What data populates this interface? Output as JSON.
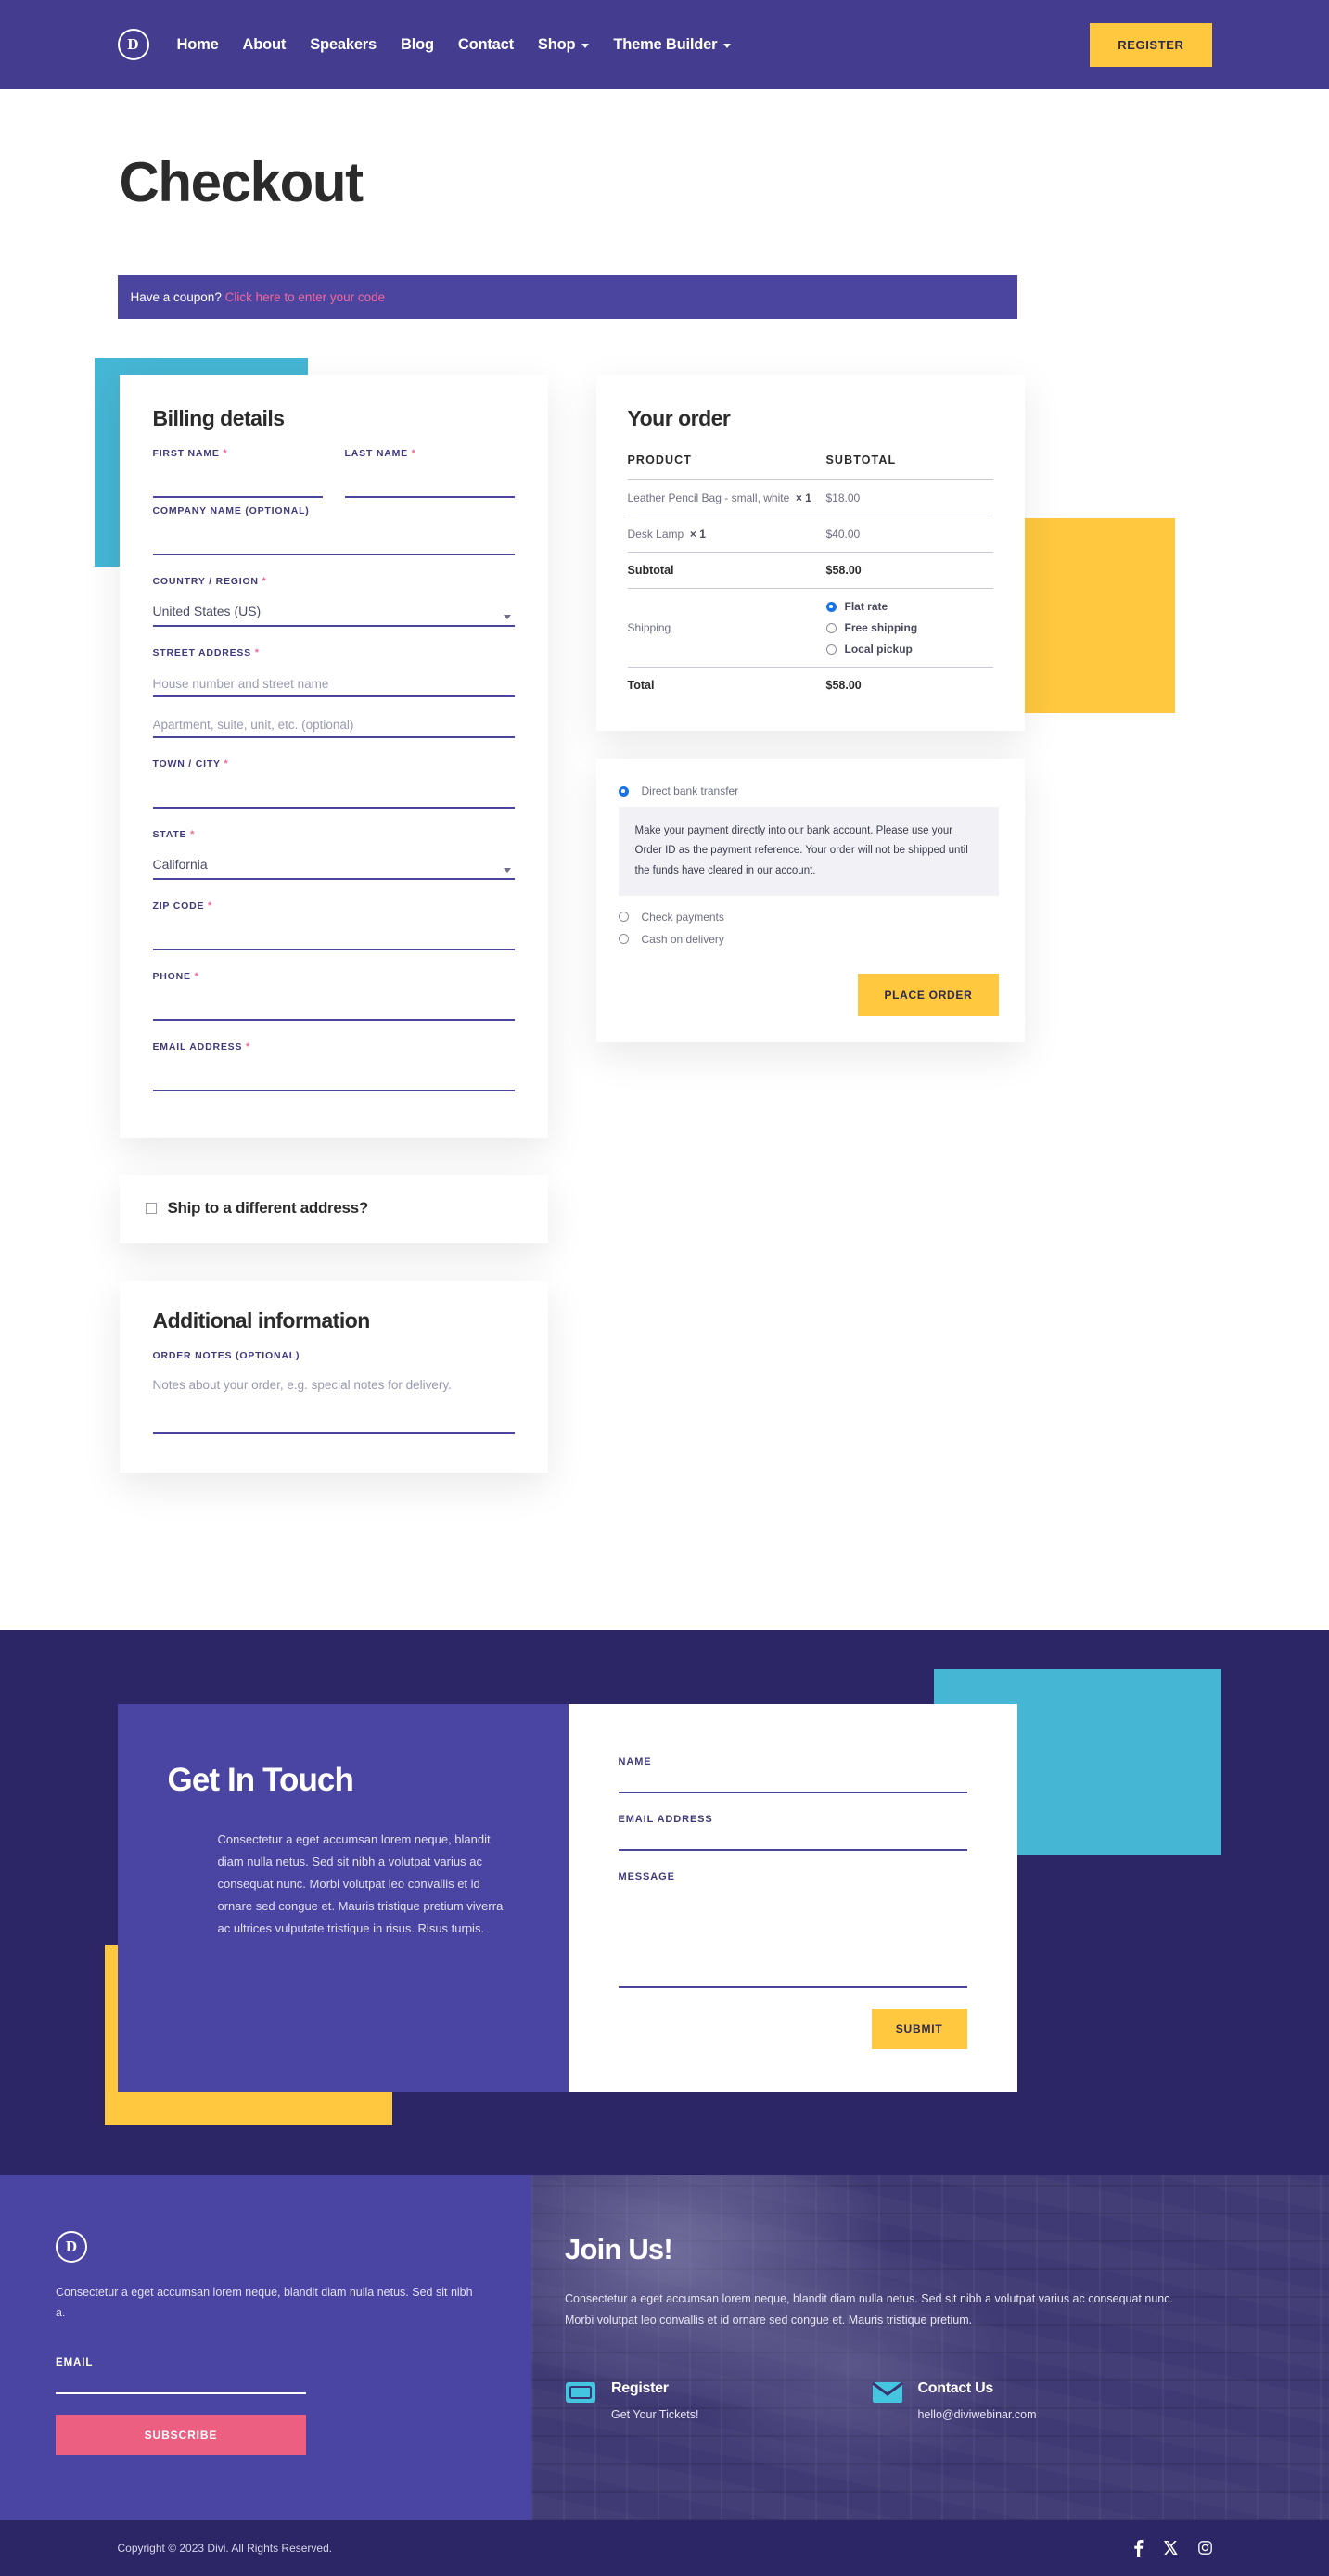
{
  "header": {
    "logo_text": "D",
    "logo_icon": "divi-logo-icon",
    "nav": [
      {
        "label": "Home",
        "has_caret": false
      },
      {
        "label": "About",
        "has_caret": false
      },
      {
        "label": "Speakers",
        "has_caret": false
      },
      {
        "label": "Blog",
        "has_caret": false
      },
      {
        "label": "Contact",
        "has_caret": false
      },
      {
        "label": "Shop",
        "has_caret": true
      },
      {
        "label": "Theme Builder",
        "has_caret": true
      }
    ],
    "register_label": "REGISTER",
    "bg_color": "#443d8f",
    "accent_color": "#ffc83e"
  },
  "page": {
    "title": "Checkout",
    "coupon_prefix": "Have a coupon?",
    "coupon_link": "Click here to enter your code"
  },
  "billing": {
    "heading": "Billing details",
    "first_name_label": "FIRST NAME",
    "last_name_label": "LAST NAME",
    "company_label": "COMPANY NAME (OPTIONAL)",
    "country_label": "COUNTRY / REGION",
    "country_value": "United States (US)",
    "street_label": "STREET ADDRESS",
    "street_placeholder": "House number and street name",
    "street2_placeholder": "Apartment, suite, unit, etc. (optional)",
    "city_label": "TOWN / CITY",
    "state_label": "STATE",
    "state_value": "California",
    "zip_label": "ZIP CODE",
    "phone_label": "PHONE",
    "email_label": "EMAIL ADDRESS",
    "required_mark": "*"
  },
  "ship_different": {
    "label": "Ship to a different address?",
    "checked": false
  },
  "additional": {
    "heading": "Additional information",
    "notes_label": "ORDER NOTES (OPTIONAL)",
    "notes_placeholder": "Notes about your order, e.g. special notes for delivery."
  },
  "order": {
    "heading": "Your order",
    "col_product": "PRODUCT",
    "col_subtotal": "SUBTOTAL",
    "items": [
      {
        "name": "Leather Pencil Bag - small, white",
        "qty": "× 1",
        "amount": "$18.00"
      },
      {
        "name": "Desk Lamp",
        "qty": "× 1",
        "amount": "$40.00"
      }
    ],
    "subtotal_label": "Subtotal",
    "subtotal_amount": "$58.00",
    "shipping_label": "Shipping",
    "shipping_options": [
      {
        "label": "Flat rate",
        "selected": true
      },
      {
        "label": "Free shipping",
        "selected": false
      },
      {
        "label": "Local pickup",
        "selected": false
      }
    ],
    "total_label": "Total",
    "total_amount": "$58.00"
  },
  "payment": {
    "options": [
      {
        "label": "Direct bank transfer",
        "selected": true
      },
      {
        "label": "Check payments",
        "selected": false
      },
      {
        "label": "Cash on delivery",
        "selected": false
      }
    ],
    "bank_note": "Make your payment directly into our bank account. Please use your Order ID as the payment reference. Your order will not be shipped until the funds have cleared in our account.",
    "place_order_label": "PLACE ORDER"
  },
  "get_in_touch": {
    "title": "Get In Touch",
    "text": "Consectetur a eget accumsan lorem neque, blandit diam nulla netus. Sed sit nibh a volutpat varius ac consequat nunc. Morbi volutpat leo convallis et id ornare sed congue et. Mauris tristique pretium viverra ac ultrices vulputate tristique in risus. Risus turpis.",
    "name_label": "NAME",
    "email_label": "EMAIL ADDRESS",
    "message_label": "MESSAGE",
    "submit_label": "SUBMIT"
  },
  "footer": {
    "logo_text": "D",
    "about_text": "Consectetur a eget accumsan lorem neque, blandit diam nulla netus. Sed sit nibh a.",
    "email_label": "EMAIL",
    "subscribe_label": "SUBSCRIBE",
    "join_title": "Join Us!",
    "join_text": "Consectetur a eget accumsan lorem neque, blandit diam nulla netus. Sed sit nibh a volutpat varius ac consequat nunc. Morbi volutpat leo convallis et id ornare sed congue et. Mauris tristique pretium.",
    "items": [
      {
        "icon": "ticket-icon",
        "title": "Register",
        "sub": "Get Your Tickets!"
      },
      {
        "icon": "envelope-icon",
        "title": "Contact Us",
        "sub": "hello@diviwebinar.com"
      }
    ],
    "copyright": "Copyright © 2023 Divi. All Rights Reserved.",
    "socials": [
      "facebook-icon",
      "x-twitter-icon",
      "instagram-icon"
    ],
    "subscribe_color": "#ed5f81"
  }
}
